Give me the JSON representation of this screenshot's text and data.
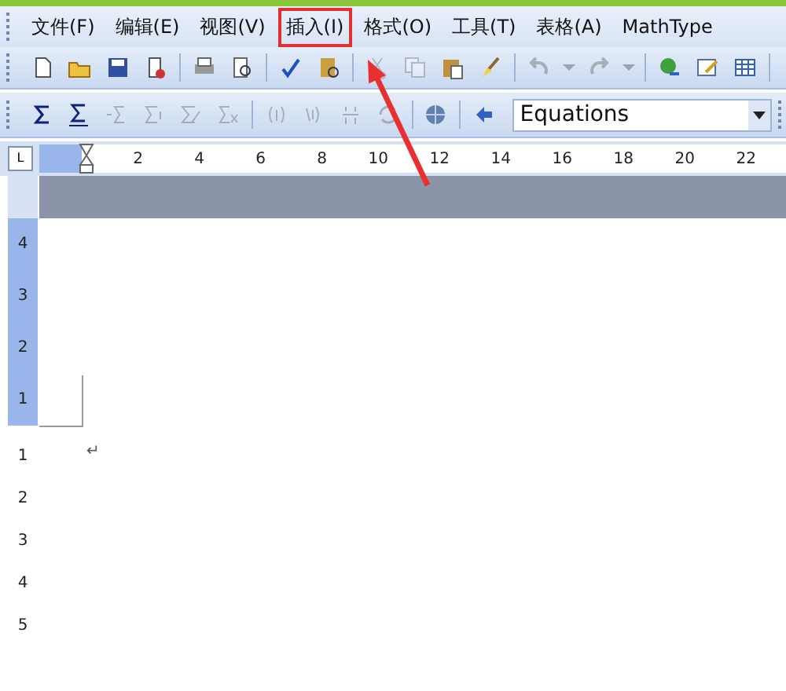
{
  "menu_bar": {
    "items": [
      {
        "label": "文件(F)",
        "selected": false
      },
      {
        "label": "编辑(E)",
        "selected": false
      },
      {
        "label": "视图(V)",
        "selected": false
      },
      {
        "label": "插入(I)",
        "selected": true
      },
      {
        "label": "格式(O)",
        "selected": false
      },
      {
        "label": "工具(T)",
        "selected": false
      },
      {
        "label": "表格(A)",
        "selected": false
      },
      {
        "label": "MathType",
        "selected": false
      }
    ]
  },
  "standard_toolbar": {
    "buttons": [
      {
        "kind": "new",
        "disabled": false
      },
      {
        "kind": "open",
        "disabled": false
      },
      {
        "kind": "save",
        "disabled": false
      },
      {
        "kind": "permission",
        "disabled": false
      },
      {
        "kind": "separator"
      },
      {
        "kind": "print",
        "disabled": false
      },
      {
        "kind": "preview",
        "disabled": false
      },
      {
        "kind": "separator"
      },
      {
        "kind": "spelling",
        "disabled": false
      },
      {
        "kind": "research",
        "disabled": false
      },
      {
        "kind": "separator"
      },
      {
        "kind": "cut",
        "disabled": true
      },
      {
        "kind": "copy",
        "disabled": true
      },
      {
        "kind": "paste",
        "disabled": false
      },
      {
        "kind": "brush",
        "disabled": false
      },
      {
        "kind": "separator"
      },
      {
        "kind": "undo",
        "disabled": true
      },
      {
        "kind": "dropdown",
        "disabled": true
      },
      {
        "kind": "redo",
        "disabled": true
      },
      {
        "kind": "dropdown",
        "disabled": true
      },
      {
        "kind": "separator"
      },
      {
        "kind": "link",
        "disabled": false
      },
      {
        "kind": "drawing",
        "disabled": false
      },
      {
        "kind": "table",
        "disabled": false
      },
      {
        "kind": "separator"
      }
    ]
  },
  "mathtype_toolbar": {
    "buttons": [
      {
        "kind": "sigma",
        "disabled": false
      },
      {
        "kind": "sigma-under",
        "disabled": false
      },
      {
        "kind": "sigma-left",
        "disabled": true
      },
      {
        "kind": "sigma-right",
        "disabled": true
      },
      {
        "kind": "sigma-edit",
        "disabled": true
      },
      {
        "kind": "sigma-x",
        "disabled": true
      },
      {
        "kind": "separator"
      },
      {
        "kind": "number",
        "disabled": true
      },
      {
        "kind": "number-ref",
        "disabled": true
      },
      {
        "kind": "fraction",
        "disabled": true
      },
      {
        "kind": "refresh",
        "disabled": true
      },
      {
        "kind": "separator"
      },
      {
        "kind": "globe",
        "disabled": false
      },
      {
        "kind": "separator"
      },
      {
        "kind": "back",
        "disabled": false
      }
    ],
    "style_dropdown": {
      "value": "Equations"
    }
  },
  "ruler": {
    "tab_selector": "L",
    "numbers": [
      "2",
      "4",
      "6",
      "8",
      "10",
      "12",
      "14",
      "16",
      "18",
      "20",
      "22"
    ]
  },
  "vertical_ruler": {
    "top_numbers": [
      "4",
      "3",
      "2",
      "1"
    ],
    "bottom_numbers": [
      "1",
      "2",
      "3",
      "4",
      "5"
    ]
  },
  "document": {
    "paragraph_mark": "↵"
  }
}
